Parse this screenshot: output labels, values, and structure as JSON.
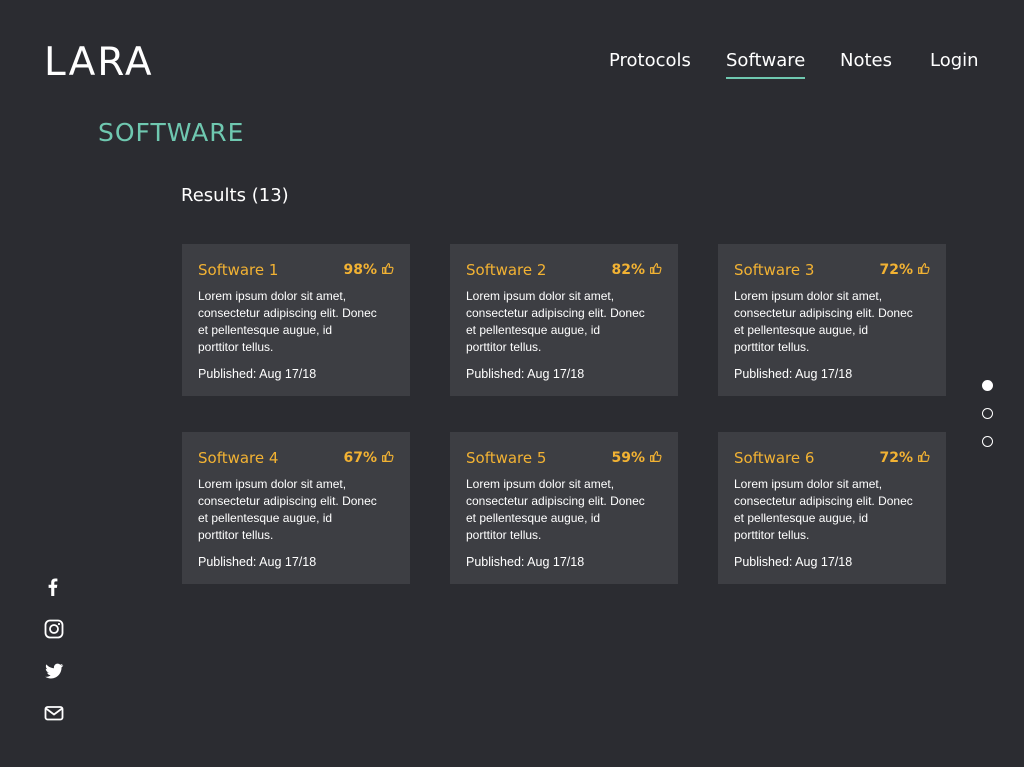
{
  "brand": {
    "logo_text": "LARA"
  },
  "nav": {
    "items": [
      {
        "label": "Protocols",
        "active": false
      },
      {
        "label": "Software",
        "active": true
      },
      {
        "label": "Notes",
        "active": false
      },
      {
        "label": "Login",
        "active": false
      }
    ]
  },
  "page": {
    "title": "SOFTWARE",
    "results_label": "Results (13)"
  },
  "cards": [
    {
      "title": "Software 1",
      "rating": "98%",
      "desc": "Lorem ipsum dolor sit amet,\nconsectetur adipiscing elit. Donec\net pellentesque augue, id\nporttitor tellus.",
      "published": "Published: Aug 17/18"
    },
    {
      "title": "Software 2",
      "rating": "82%",
      "desc": "Lorem ipsum dolor sit amet,\nconsectetur adipiscing elit. Donec\net pellentesque augue, id\nporttitor tellus.",
      "published": "Published: Aug 17/18"
    },
    {
      "title": "Software 3",
      "rating": "72%",
      "desc": "Lorem ipsum dolor sit amet,\nconsectetur adipiscing elit. Donec\net pellentesque augue, id\nporttitor tellus.",
      "published": "Published: Aug 17/18"
    },
    {
      "title": "Software 4",
      "rating": "67%",
      "desc": "Lorem ipsum dolor sit amet,\nconsectetur adipiscing elit. Donec\net pellentesque augue, id\nporttitor tellus.",
      "published": "Published: Aug 17/18"
    },
    {
      "title": "Software 5",
      "rating": "59%",
      "desc": "Lorem ipsum dolor sit amet,\nconsectetur adipiscing elit. Donec\net pellentesque augue, id\nporttitor tellus.",
      "published": "Published: Aug 17/18"
    },
    {
      "title": "Software 6",
      "rating": "72%",
      "desc": "Lorem ipsum dolor sit amet,\nconsectetur adipiscing elit. Donec\net pellentesque augue, id\nporttitor tellus.",
      "published": "Published: Aug 17/18"
    }
  ],
  "pagination": {
    "pages": 3,
    "current": 1
  },
  "social": [
    "facebook-icon",
    "instagram-icon",
    "twitter-icon",
    "mail-icon"
  ],
  "colors": {
    "background": "#2b2c31",
    "card": "#3d3e43",
    "accent": "#6fc8b0",
    "highlight": "#f2b233"
  }
}
